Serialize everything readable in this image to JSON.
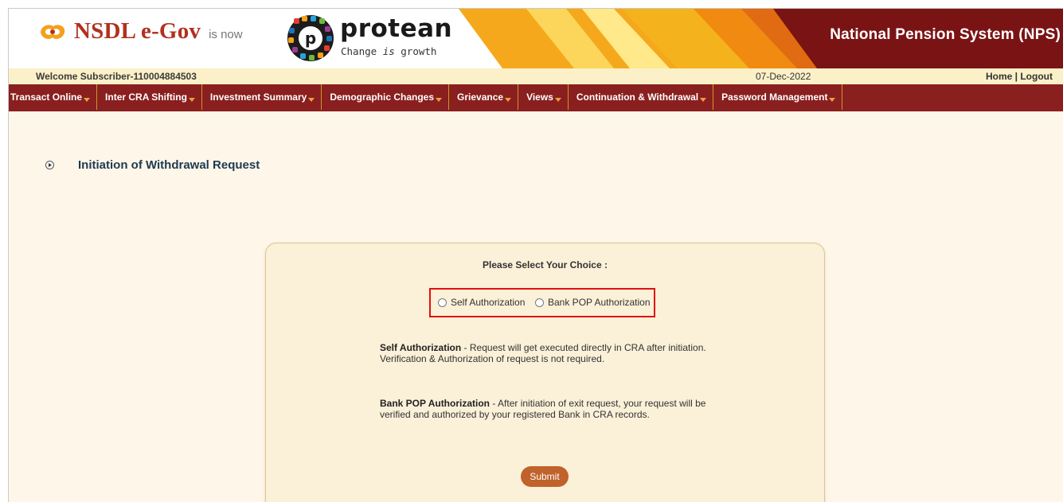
{
  "header": {
    "brand": "NSDL e-Gov",
    "is_now": "is now",
    "protean": "protean",
    "tagline": "Change is growth",
    "system_title": "National Pension System (NPS)"
  },
  "welcome_bar": {
    "welcome": "Welcome Subscriber-110004884503",
    "date": "07-Dec-2022",
    "home": "Home",
    "separator": "|",
    "logout": "Logout"
  },
  "nav": {
    "items": [
      {
        "label": "Transact Online"
      },
      {
        "label": "Inter CRA Shifting"
      },
      {
        "label": "Investment Summary"
      },
      {
        "label": "Demographic Changes"
      },
      {
        "label": "Grievance"
      },
      {
        "label": "Views"
      },
      {
        "label": "Continuation & Withdrawal"
      },
      {
        "label": "Password Management"
      }
    ]
  },
  "page": {
    "title": "Initiation of Withdrawal Request"
  },
  "form": {
    "choice_title": "Please Select Your Choice :",
    "options": [
      {
        "label": "Self Authorization",
        "selected": false
      },
      {
        "label": "Bank POP Authorization",
        "selected": false
      }
    ],
    "self_desc_title": "Self Authorization",
    "self_desc_line1": " - Request will get executed directly in CRA after initiation.",
    "self_desc_line2": "Verification & Authorization of request is not required.",
    "bank_desc_title": "Bank POP Authorization",
    "bank_desc_line1": " - After initiation of exit request, your request will be",
    "bank_desc_line2": "verified and authorized by your registered Bank in CRA records.",
    "submit_label": "Submit"
  },
  "colors": {
    "nav_bg": "#8a1f1f",
    "header_right_bg": "#7a1414",
    "welcome_bg": "#fbf0c8",
    "panel_bg": "#fbf0d8",
    "highlight_border": "#e01010",
    "submit_bg": "#c0622b"
  },
  "icons": {
    "brand_logo": "nsdl-logo-icon",
    "protean_logo": "protean-logo-icon",
    "nav_caret": "caret-down-icon",
    "heading_bullet": "circle-arrow-icon"
  }
}
